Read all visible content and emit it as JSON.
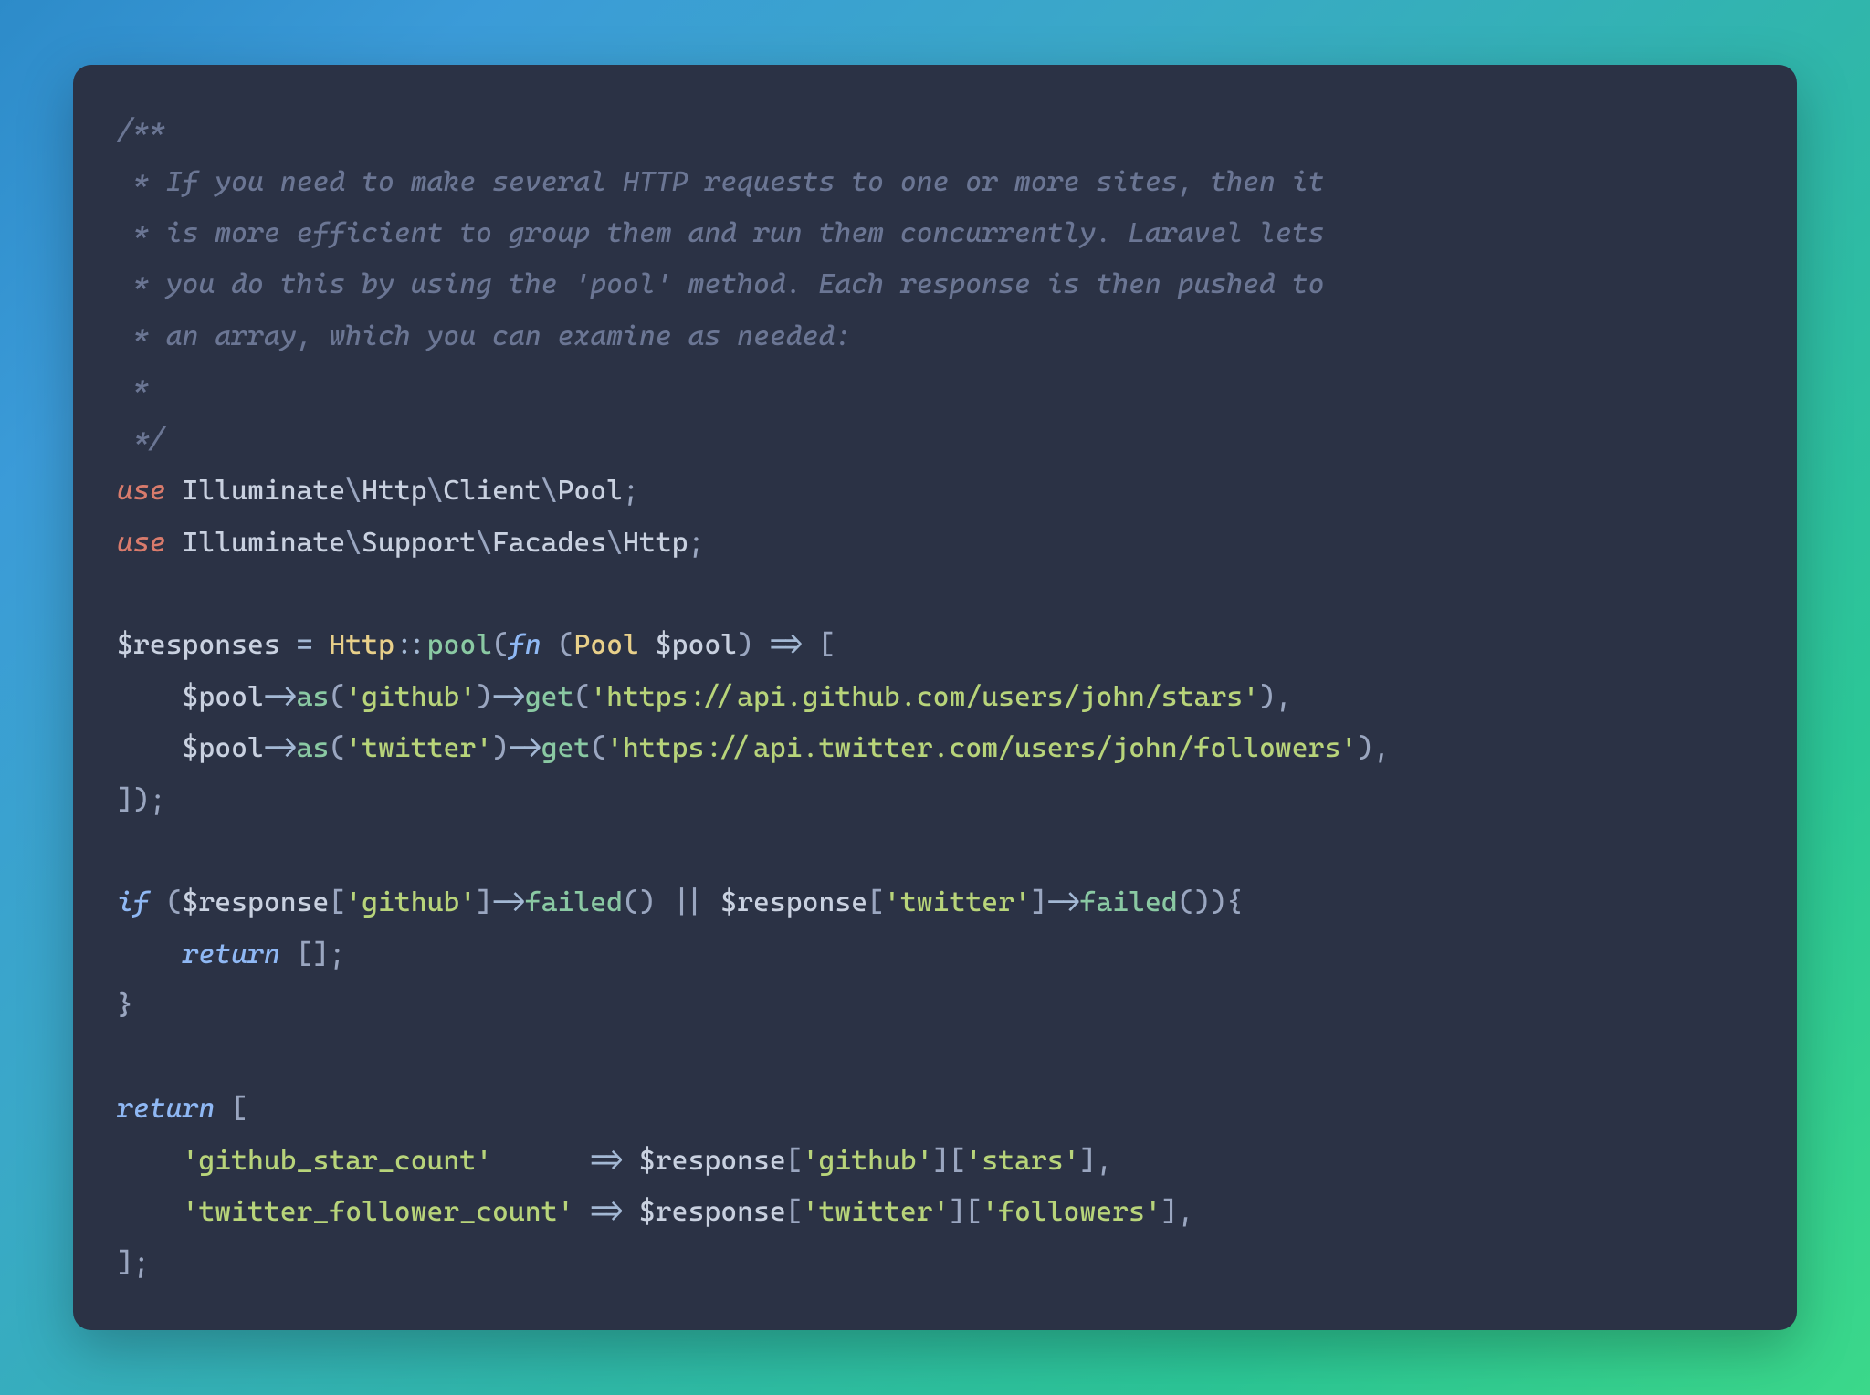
{
  "code": {
    "lines": [
      {
        "indent": 0,
        "tokens": [
          {
            "t": "/**",
            "c": "c-comment"
          }
        ]
      },
      {
        "indent": 0,
        "tokens": [
          {
            "t": " * If you need to make several HTTP requests to one or more sites, then it",
            "c": "c-comment"
          }
        ]
      },
      {
        "indent": 0,
        "tokens": [
          {
            "t": " * is more efficient to group them and run them concurrently. Laravel lets",
            "c": "c-comment"
          }
        ]
      },
      {
        "indent": 0,
        "tokens": [
          {
            "t": " * you do this by using the 'pool' method. Each response is then pushed to",
            "c": "c-comment"
          }
        ]
      },
      {
        "indent": 0,
        "tokens": [
          {
            "t": " * an array, which you can examine as needed:",
            "c": "c-comment"
          }
        ]
      },
      {
        "indent": 0,
        "tokens": [
          {
            "t": " *",
            "c": "c-comment"
          }
        ]
      },
      {
        "indent": 0,
        "tokens": [
          {
            "t": " */",
            "c": "c-comment"
          }
        ]
      },
      {
        "indent": 0,
        "tokens": [
          {
            "t": "use",
            "c": "c-keyword"
          },
          {
            "t": " ",
            "c": ""
          },
          {
            "t": "Illuminate",
            "c": "c-ns"
          },
          {
            "t": "\\",
            "c": "c-punct"
          },
          {
            "t": "Http",
            "c": "c-ns"
          },
          {
            "t": "\\",
            "c": "c-punct"
          },
          {
            "t": "Client",
            "c": "c-ns"
          },
          {
            "t": "\\",
            "c": "c-punct"
          },
          {
            "t": "Pool",
            "c": "c-ns"
          },
          {
            "t": ";",
            "c": "c-punct"
          }
        ]
      },
      {
        "indent": 0,
        "tokens": [
          {
            "t": "use",
            "c": "c-keyword"
          },
          {
            "t": " ",
            "c": ""
          },
          {
            "t": "Illuminate",
            "c": "c-ns"
          },
          {
            "t": "\\",
            "c": "c-punct"
          },
          {
            "t": "Support",
            "c": "c-ns"
          },
          {
            "t": "\\",
            "c": "c-punct"
          },
          {
            "t": "Facades",
            "c": "c-ns"
          },
          {
            "t": "\\",
            "c": "c-punct"
          },
          {
            "t": "Http",
            "c": "c-ns"
          },
          {
            "t": ";",
            "c": "c-punct"
          }
        ]
      },
      {
        "indent": 0,
        "tokens": [
          {
            "t": "",
            "c": ""
          }
        ]
      },
      {
        "indent": 0,
        "tokens": [
          {
            "t": "$responses",
            "c": "c-var"
          },
          {
            "t": " = ",
            "c": "c-op"
          },
          {
            "t": "Http",
            "c": "c-class"
          },
          {
            "t": "::",
            "c": "c-op"
          },
          {
            "t": "pool",
            "c": "c-func"
          },
          {
            "t": "(",
            "c": "c-punct"
          },
          {
            "t": "fn",
            "c": "c-keyword2"
          },
          {
            "t": " (",
            "c": "c-punct"
          },
          {
            "t": "Pool",
            "c": "c-class"
          },
          {
            "t": " ",
            "c": ""
          },
          {
            "t": "$pool",
            "c": "c-var"
          },
          {
            "t": ") ",
            "c": "c-punct"
          },
          {
            "t": "=>",
            "c": "c-op"
          },
          {
            "t": " [",
            "c": "c-punct"
          }
        ]
      },
      {
        "indent": 1,
        "tokens": [
          {
            "t": "$pool",
            "c": "c-var"
          },
          {
            "t": "->",
            "c": "c-op"
          },
          {
            "t": "as",
            "c": "c-func"
          },
          {
            "t": "(",
            "c": "c-punct"
          },
          {
            "t": "'github'",
            "c": "c-string"
          },
          {
            "t": ")",
            "c": "c-punct"
          },
          {
            "t": "->",
            "c": "c-op"
          },
          {
            "t": "get",
            "c": "c-func"
          },
          {
            "t": "(",
            "c": "c-punct"
          },
          {
            "t": "'https://api.github.com/users/john/stars'",
            "c": "c-string"
          },
          {
            "t": "),",
            "c": "c-punct"
          }
        ]
      },
      {
        "indent": 1,
        "tokens": [
          {
            "t": "$pool",
            "c": "c-var"
          },
          {
            "t": "->",
            "c": "c-op"
          },
          {
            "t": "as",
            "c": "c-func"
          },
          {
            "t": "(",
            "c": "c-punct"
          },
          {
            "t": "'twitter'",
            "c": "c-string"
          },
          {
            "t": ")",
            "c": "c-punct"
          },
          {
            "t": "->",
            "c": "c-op"
          },
          {
            "t": "get",
            "c": "c-func"
          },
          {
            "t": "(",
            "c": "c-punct"
          },
          {
            "t": "'https://api.twitter.com/users/john/followers'",
            "c": "c-string"
          },
          {
            "t": "),",
            "c": "c-punct"
          }
        ]
      },
      {
        "indent": 0,
        "tokens": [
          {
            "t": "]);",
            "c": "c-punct"
          }
        ]
      },
      {
        "indent": 0,
        "tokens": [
          {
            "t": "",
            "c": ""
          }
        ]
      },
      {
        "indent": 0,
        "tokens": [
          {
            "t": "if",
            "c": "c-keyword2"
          },
          {
            "t": " (",
            "c": "c-punct"
          },
          {
            "t": "$response",
            "c": "c-var"
          },
          {
            "t": "[",
            "c": "c-punct"
          },
          {
            "t": "'github'",
            "c": "c-string"
          },
          {
            "t": "]",
            "c": "c-punct"
          },
          {
            "t": "->",
            "c": "c-op"
          },
          {
            "t": "failed",
            "c": "c-func"
          },
          {
            "t": "() || ",
            "c": "c-punct"
          },
          {
            "t": "$response",
            "c": "c-var"
          },
          {
            "t": "[",
            "c": "c-punct"
          },
          {
            "t": "'twitter'",
            "c": "c-string"
          },
          {
            "t": "]",
            "c": "c-punct"
          },
          {
            "t": "->",
            "c": "c-op"
          },
          {
            "t": "failed",
            "c": "c-func"
          },
          {
            "t": "()){",
            "c": "c-punct"
          }
        ]
      },
      {
        "indent": 1,
        "tokens": [
          {
            "t": "return",
            "c": "c-keyword2"
          },
          {
            "t": " [];",
            "c": "c-punct"
          }
        ]
      },
      {
        "indent": 0,
        "tokens": [
          {
            "t": "}",
            "c": "c-punct"
          }
        ]
      },
      {
        "indent": 0,
        "tokens": [
          {
            "t": "",
            "c": ""
          }
        ]
      },
      {
        "indent": 0,
        "tokens": [
          {
            "t": "return",
            "c": "c-keyword2"
          },
          {
            "t": " [",
            "c": "c-punct"
          }
        ]
      },
      {
        "indent": 1,
        "tokens": [
          {
            "t": "'github_star_count'",
            "c": "c-string"
          },
          {
            "t": "      ",
            "c": ""
          },
          {
            "t": "=>",
            "c": "c-op"
          },
          {
            "t": " ",
            "c": ""
          },
          {
            "t": "$response",
            "c": "c-var"
          },
          {
            "t": "[",
            "c": "c-punct"
          },
          {
            "t": "'github'",
            "c": "c-string"
          },
          {
            "t": "][",
            "c": "c-punct"
          },
          {
            "t": "'stars'",
            "c": "c-string"
          },
          {
            "t": "],",
            "c": "c-punct"
          }
        ]
      },
      {
        "indent": 1,
        "tokens": [
          {
            "t": "'twitter_follower_count'",
            "c": "c-string"
          },
          {
            "t": " ",
            "c": ""
          },
          {
            "t": "=>",
            "c": "c-op"
          },
          {
            "t": " ",
            "c": ""
          },
          {
            "t": "$response",
            "c": "c-var"
          },
          {
            "t": "[",
            "c": "c-punct"
          },
          {
            "t": "'twitter'",
            "c": "c-string"
          },
          {
            "t": "][",
            "c": "c-punct"
          },
          {
            "t": "'followers'",
            "c": "c-string"
          },
          {
            "t": "],",
            "c": "c-punct"
          }
        ]
      },
      {
        "indent": 0,
        "tokens": [
          {
            "t": "];",
            "c": "c-punct"
          }
        ]
      }
    ]
  }
}
